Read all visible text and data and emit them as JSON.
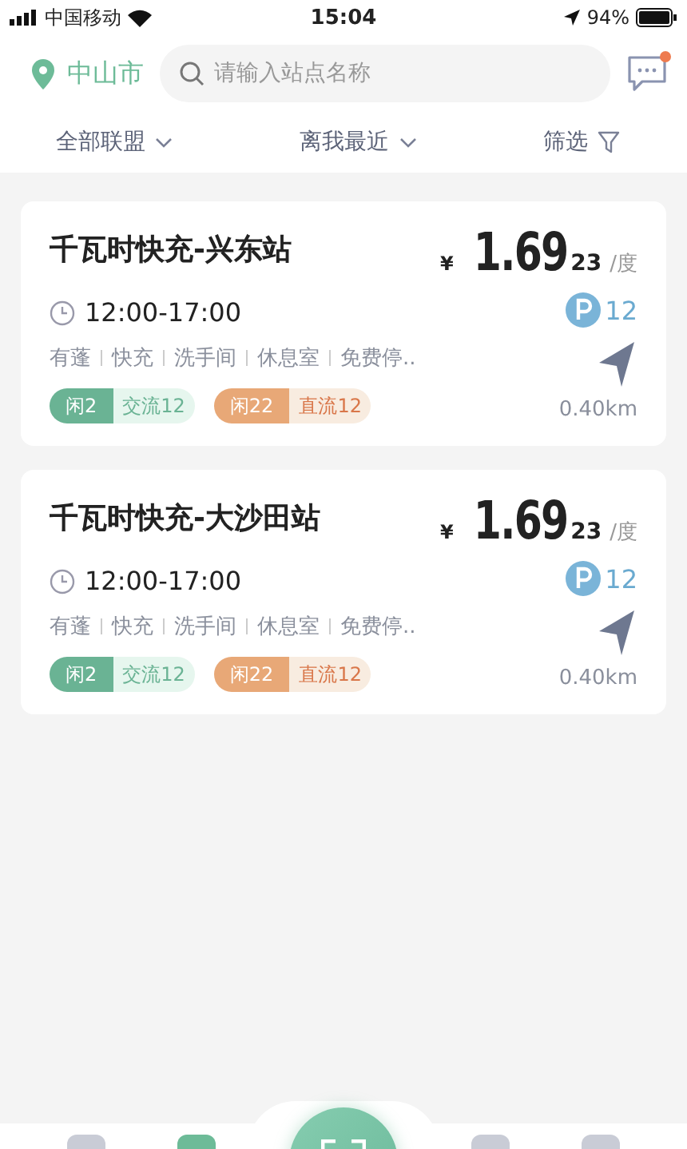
{
  "status_bar": {
    "carrier": "中国移动",
    "time": "15:04",
    "battery": "94%"
  },
  "header": {
    "city": "中山市",
    "search": {
      "placeholder": "请输入站点名称"
    },
    "messages_unread": true
  },
  "filters": [
    {
      "label": "全部联盟",
      "kind": "dropdown"
    },
    {
      "label": "离我最近",
      "kind": "dropdown"
    },
    {
      "label": "筛选",
      "kind": "filter"
    }
  ],
  "stations": [
    {
      "name": "千瓦时快充-兴东站",
      "currency": "¥",
      "price": "1.69",
      "price_fraction": "23",
      "unit": "/度",
      "hours": "12:00-17:00",
      "parking": "12",
      "amenities": [
        "有蓬",
        "快充",
        "洗手间",
        "休息室",
        "免费停.."
      ],
      "chargers": [
        {
          "idle": "闲2",
          "type": "交流12",
          "kind": "ac"
        },
        {
          "idle": "闲22",
          "type": "直流12",
          "kind": "dc"
        }
      ],
      "distance": "0.40km"
    },
    {
      "name": "千瓦时快充-大沙田站",
      "currency": "¥",
      "price": "1.69",
      "price_fraction": "23",
      "unit": "/度",
      "hours": "12:00-17:00",
      "parking": "12",
      "amenities": [
        "有蓬",
        "快充",
        "洗手间",
        "休息室",
        "免费停.."
      ],
      "chargers": [
        {
          "idle": "闲2",
          "type": "交流12",
          "kind": "ac"
        },
        {
          "idle": "闲22",
          "type": "直流12",
          "kind": "dc"
        }
      ],
      "distance": "0.40km"
    }
  ],
  "tab_bar": [
    {
      "selected": false
    },
    {
      "selected": true
    },
    {
      "selected": false
    },
    {
      "selected": false
    }
  ]
}
